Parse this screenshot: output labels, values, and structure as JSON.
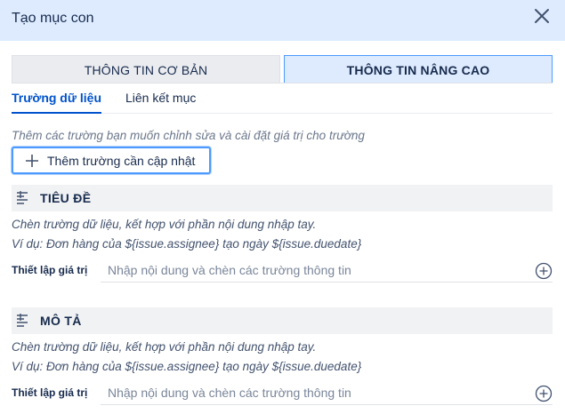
{
  "dialog": {
    "title": "Tạo mục con",
    "close_icon": "close-icon"
  },
  "tabs": [
    {
      "label": "THÔNG TIN CƠ BẢN",
      "active": false
    },
    {
      "label": "THÔNG TIN NÂNG CAO",
      "active": true
    }
  ],
  "subtabs": [
    {
      "label": "Trường dữ liệu",
      "active": true
    },
    {
      "label": "Liên kết mục",
      "active": false
    }
  ],
  "hint": "Thêm các trường bạn muốn chỉnh sửa và cài đặt giá trị cho trường",
  "add_button": {
    "label": "Thêm trường cần cập nhật",
    "icon": "plus-icon"
  },
  "sections": [
    {
      "name": "TIÊU ĐỀ",
      "icon": "text-lines-icon",
      "desc1": "Chèn trường dữ liệu, kết hợp với phần nội dung nhập tay.",
      "desc2": "Ví dụ: Đơn hàng của ${issue.assignee} tạo ngày ${issue.duedate}",
      "field_label": "Thiết lập giá trị",
      "placeholder": "Nhập nội dung và chèn các trường thông tin",
      "add_icon": "plus-circle-icon"
    },
    {
      "name": "MÔ TẢ",
      "icon": "text-lines-icon",
      "desc1": "Chèn trường dữ liệu, kết hợp với phần nội dung nhập tay.",
      "desc2": "Ví dụ: Đơn hàng của ${issue.assignee} tạo ngày ${issue.duedate}",
      "field_label": "Thiết lập giá trị",
      "placeholder": "Nhập nội dung và chèn các trường thông tin",
      "add_icon": "plus-circle-icon"
    }
  ],
  "colors": {
    "header_bg": "#deebff",
    "accent": "#0052cc",
    "focus_border": "#4c9aff"
  }
}
